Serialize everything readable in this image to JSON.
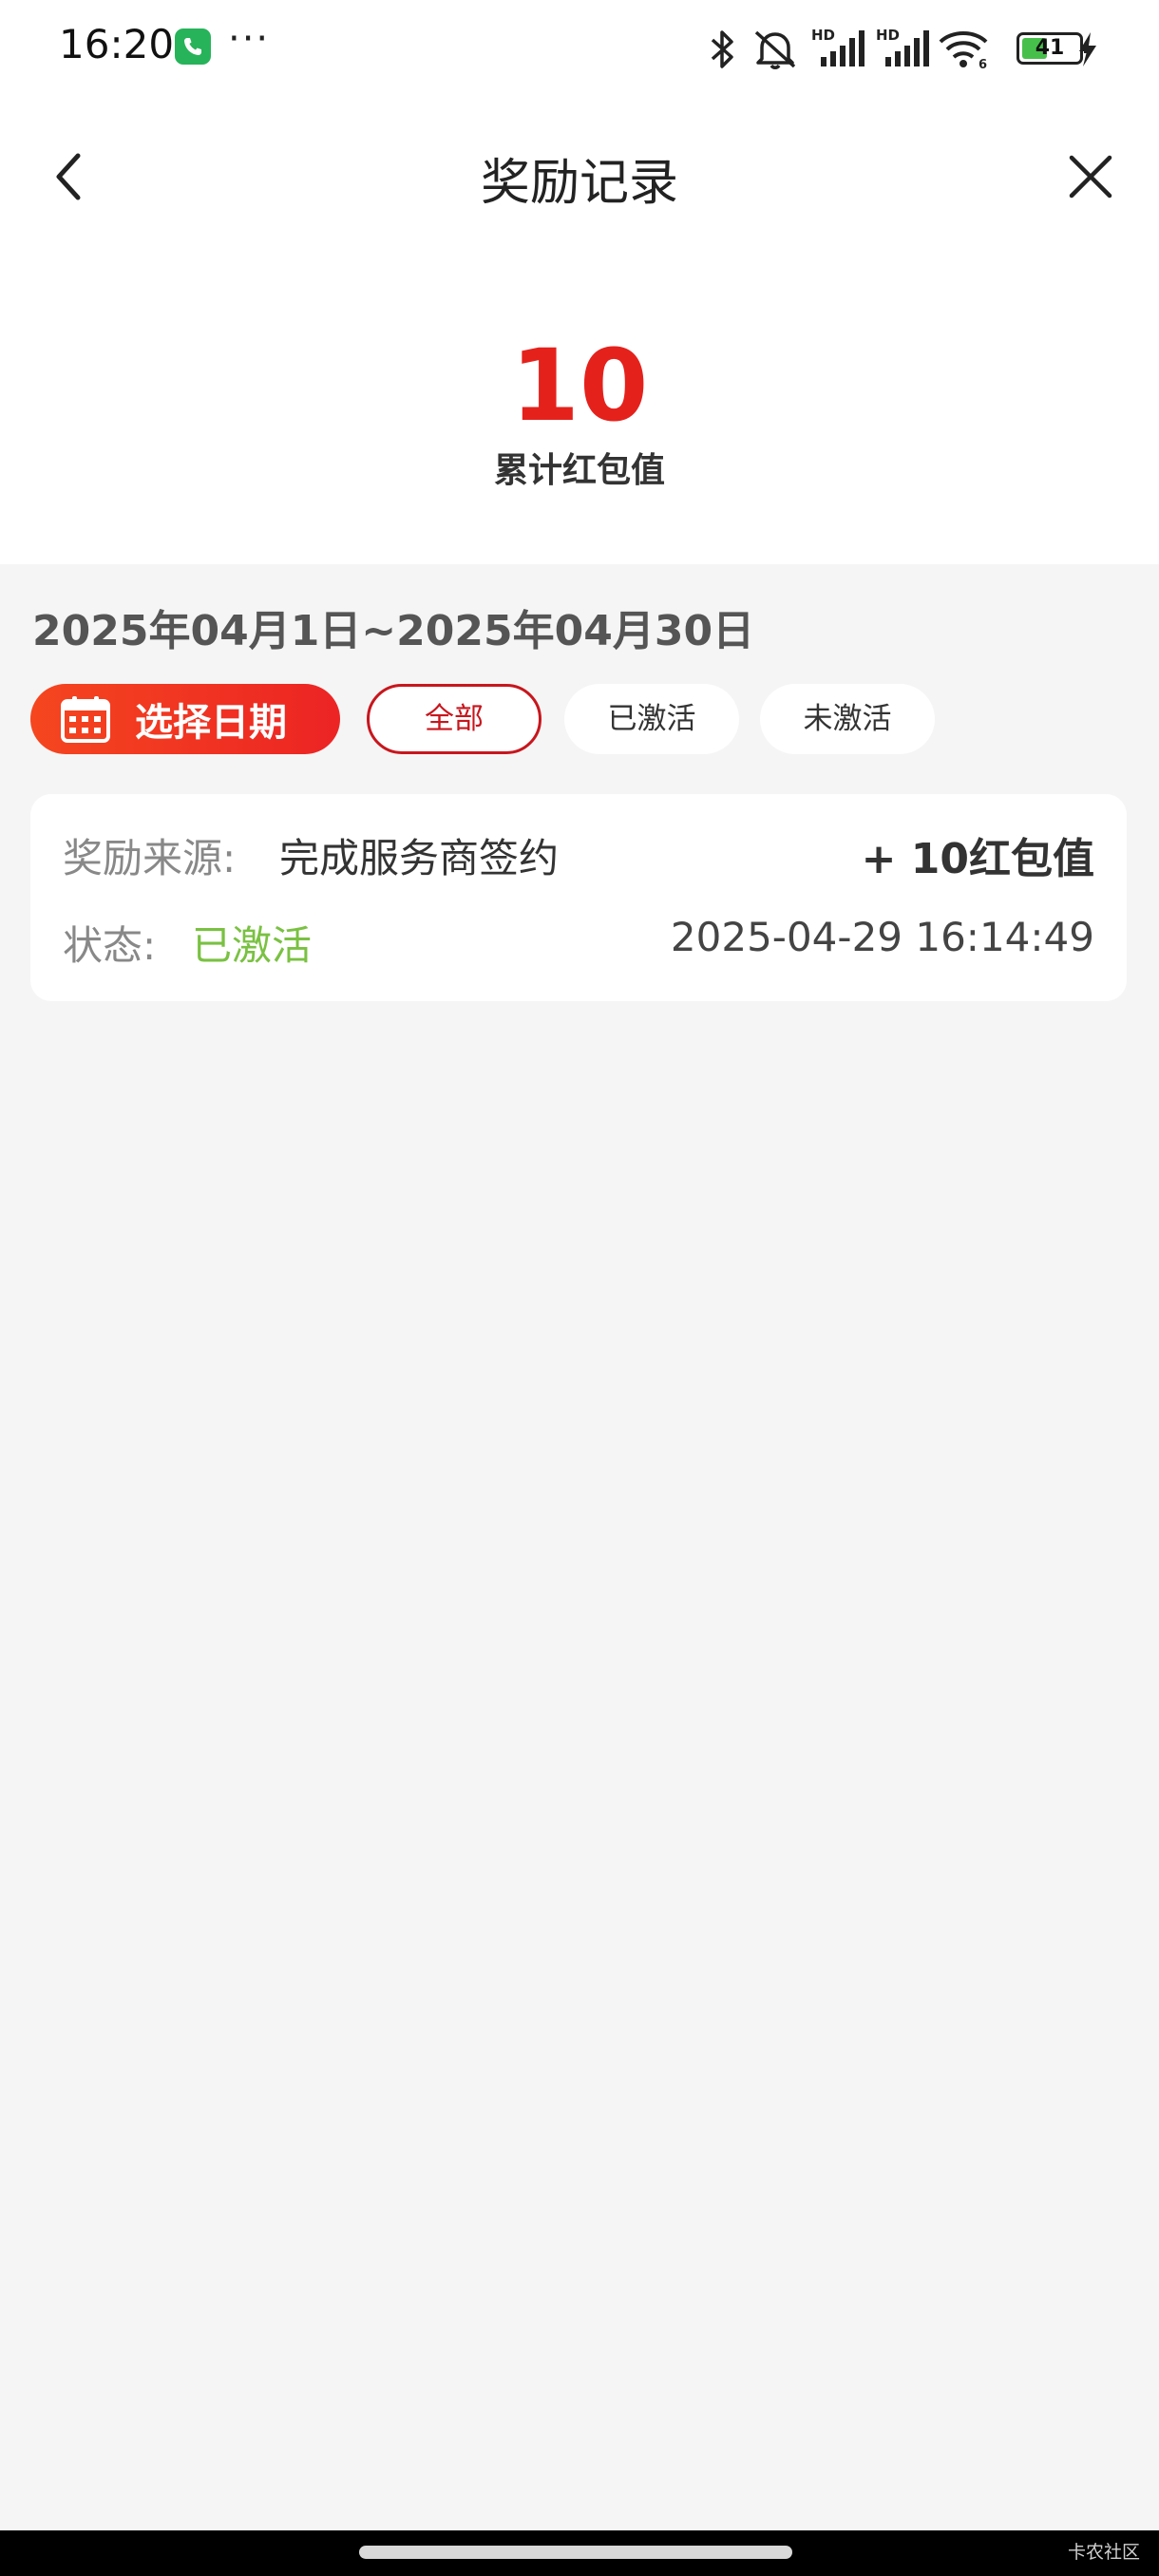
{
  "status_bar": {
    "time": "16:20",
    "dots": "···",
    "battery_level": "41",
    "icons": [
      "phone-icon",
      "bluetooth-icon",
      "mute-icon",
      "signal-hd-icon",
      "signal-hd-icon",
      "wifi-icon",
      "battery-icon",
      "charging-icon"
    ]
  },
  "nav": {
    "title": "奖励记录",
    "back_icon": "chevron-left-icon",
    "close_icon": "close-icon"
  },
  "summary": {
    "total_value": "10",
    "total_label": "累计红包值"
  },
  "filter": {
    "date_range": "2025年04月1日~2025年04月30日",
    "select_date_label": "选择日期",
    "chips": [
      {
        "label": "全部",
        "active": true
      },
      {
        "label": "已激活",
        "active": false
      },
      {
        "label": "未激活",
        "active": false
      }
    ]
  },
  "records": [
    {
      "source_label": "奖励来源:",
      "source_value": "完成服务商签约",
      "amount": "+ 10红包值",
      "status_label": "状态:",
      "status_value": "已激活",
      "time": "2025-04-29 16:14:49"
    }
  ],
  "colors": {
    "accent_red": "#e5211c",
    "active_chip": "#c8161d",
    "status_green": "#7ac142",
    "background": "#f5f5f5"
  },
  "watermark": "卡农社区"
}
